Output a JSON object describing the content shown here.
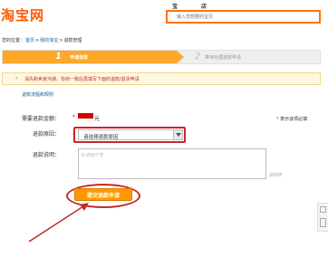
{
  "header": {
    "logo_text": "淘宝网",
    "search_tabs": [
      "宝贝",
      "店铺"
    ],
    "search_placeholder": "输入您想要的宝贝"
  },
  "breadcrumb": {
    "prefix": "您的位置：",
    "items": [
      "首页",
      "我的淘宝",
      "退款管理"
    ],
    "separator": ">"
  },
  "steps": [
    {
      "number": "1",
      "label": "申请退款",
      "active": true
    },
    {
      "number": "2",
      "label": "等待处理退款申请",
      "active": false
    }
  ],
  "notice": {
    "text": "请先和卖家沟通，协商一致后再填写下面的退款/退货申请"
  },
  "rules_link": "退款流程和规则",
  "form": {
    "amount_label": "需要退款金额：",
    "amount_unit": "元",
    "required_star": "*",
    "required_note": "表示该项必填",
    "reason_label": "退款原因：",
    "reason_selected": "请选择退款原因",
    "desc_label": "退款说明：",
    "desc_placeholder": "0-200个字",
    "desc_count": "200字",
    "submit_label": "提交退款申请"
  },
  "colors": {
    "brand": "#ff5a00",
    "step_active": "#ffa726",
    "submit": "#ff9900",
    "annotation": "#c62828"
  }
}
